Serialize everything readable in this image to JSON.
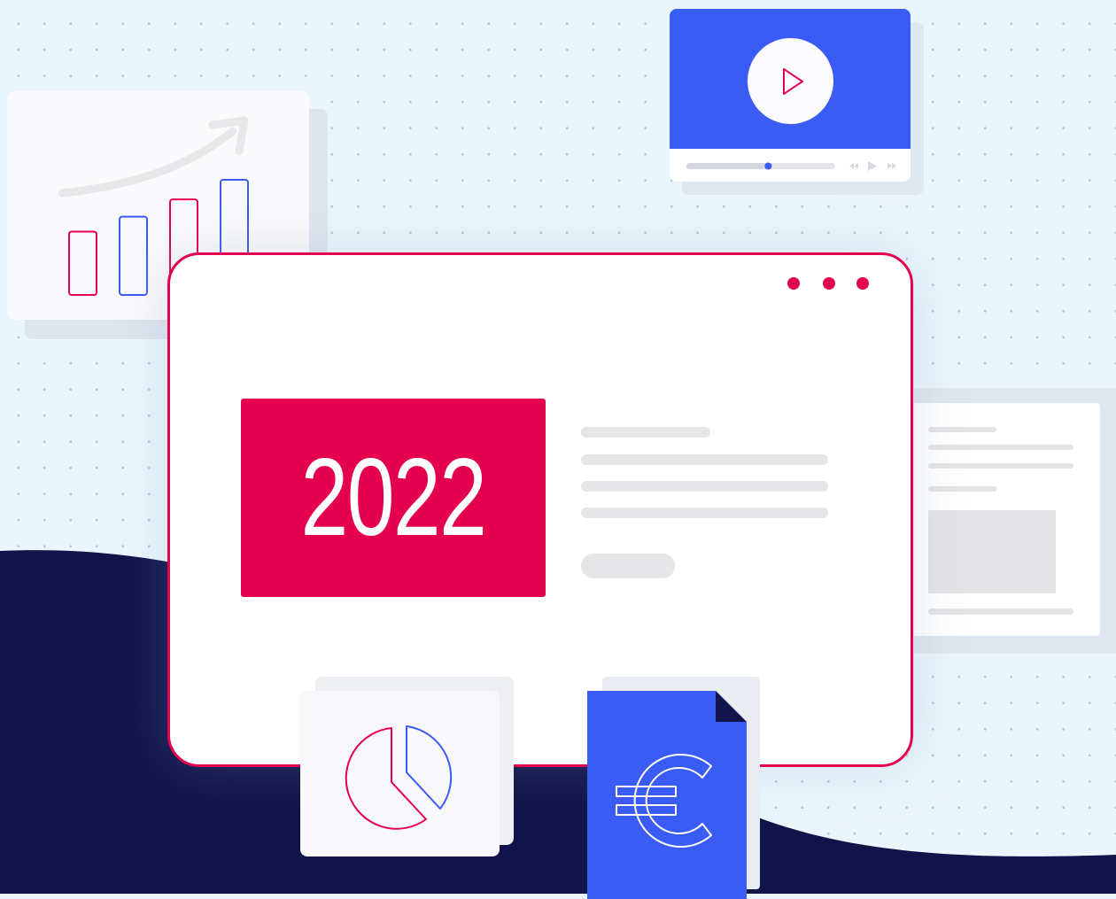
{
  "badge": {
    "year": "2022"
  },
  "colors": {
    "background": "#eaf6fd",
    "navy_wave": "#10144a",
    "accent_red": "#e5004f",
    "accent_blue": "#3b5bf5",
    "placeholder_gray": "#e6e6e8"
  },
  "icons": {
    "chart": "bar-chart-trend-icon",
    "video": "play-icon",
    "pie": "pie-chart-icon",
    "file": "euro-file-icon"
  },
  "video": {
    "progress": 0.52
  },
  "bar_chart_illustration": {
    "bar_levels": [
      0.55,
      0.68,
      0.83,
      1.0
    ]
  }
}
